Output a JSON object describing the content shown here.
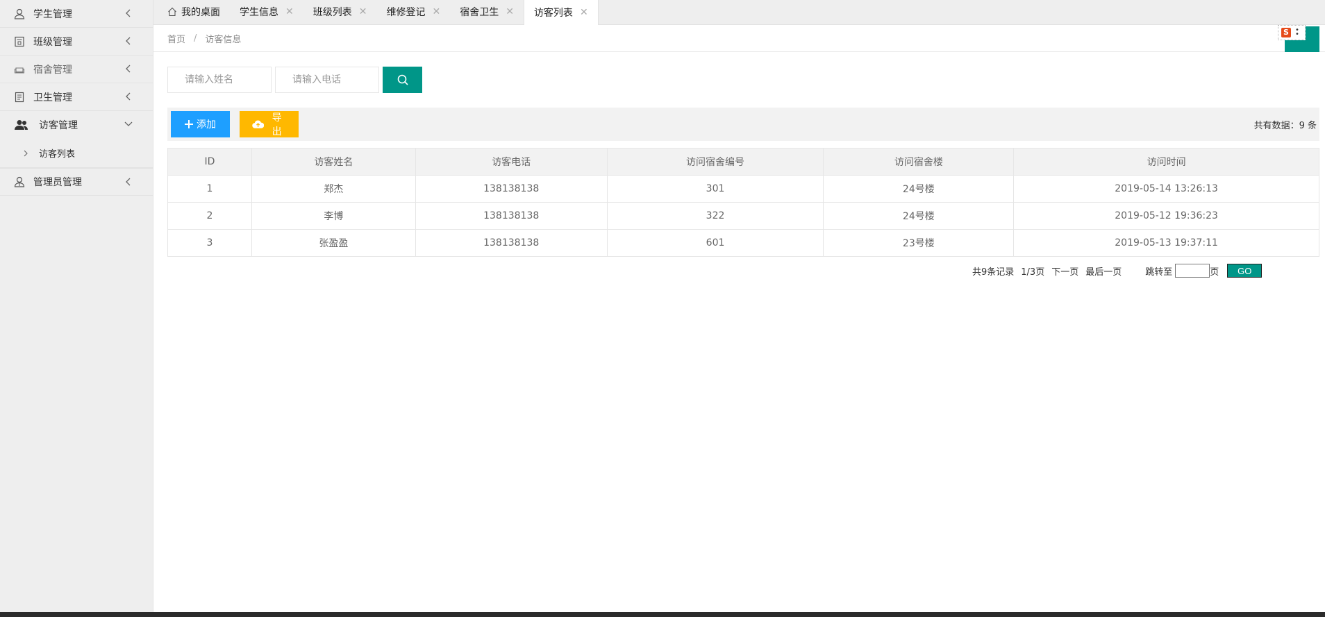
{
  "sidebar": {
    "items": [
      {
        "label": "学生管理",
        "icon": "user-icon"
      },
      {
        "label": "班级管理",
        "icon": "class-icon"
      },
      {
        "label": "宿舍管理",
        "icon": "sofa-icon"
      },
      {
        "label": "卫生管理",
        "icon": "notebook-icon"
      },
      {
        "label": "访客管理",
        "icon": "users-icon",
        "sub": [
          {
            "label": "访客列表"
          }
        ]
      },
      {
        "label": "管理员管理",
        "icon": "admin-icon"
      }
    ]
  },
  "tabs": [
    {
      "label": "我的桌面"
    },
    {
      "label": "学生信息"
    },
    {
      "label": "班级列表"
    },
    {
      "label": "维修登记"
    },
    {
      "label": "宿舍卫生"
    },
    {
      "label": "访客列表"
    }
  ],
  "breadcrumb": {
    "home": "首页",
    "sep": "/",
    "current": "访客信息"
  },
  "search": {
    "name_placeholder": "请输入姓名",
    "phone_placeholder": "请输入电话"
  },
  "toolbar": {
    "add_label": "添加",
    "export_label": "导出",
    "total_text": "共有数据：9 条"
  },
  "table": {
    "headers": [
      "ID",
      "访客姓名",
      "访客电话",
      "访问宿舍编号",
      "访问宿舍楼",
      "访问时间"
    ],
    "rows": [
      [
        "1",
        "郑杰",
        "138138138",
        "301",
        "24号楼",
        "2019-05-14 13:26:13"
      ],
      [
        "2",
        "李博",
        "138138138",
        "322",
        "24号楼",
        "2019-05-12 19:36:23"
      ],
      [
        "3",
        "张盈盈",
        "138138138",
        "601",
        "23号楼",
        "2019-05-13 19:37:11"
      ]
    ]
  },
  "pager": {
    "records": "共9条记录",
    "pages": "1/3页",
    "next": "下一页",
    "last": "最后一页",
    "jump": "跳转至",
    "page_unit": "页",
    "go": "GO"
  },
  "colors": {
    "primary": "#009688",
    "blue": "#1E9FFF",
    "orange": "#FFB800"
  }
}
